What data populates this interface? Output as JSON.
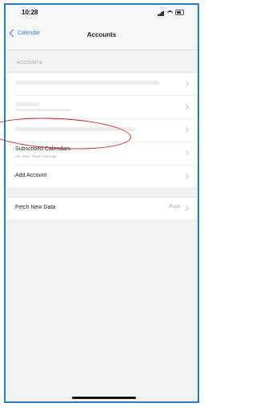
{
  "status": {
    "time": "10:28"
  },
  "nav": {
    "back_label": "Calendar",
    "title": "Accounts"
  },
  "accounts": {
    "header": "ACCOUNTS",
    "subscribed": {
      "title": "Subscribed Calendars",
      "subtitle": "US, 2020 Travel Calendar"
    },
    "add_account": "Add Account"
  },
  "fetch": {
    "label": "Fetch New Data",
    "value": "Push"
  },
  "colors": {
    "accent": "#3a7bd5",
    "annotation": "#c0282c",
    "frame": "#1f7fd6"
  }
}
